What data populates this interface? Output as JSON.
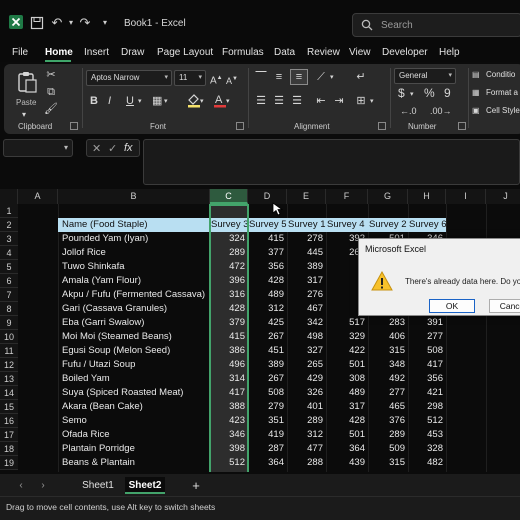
{
  "window": {
    "title": "Book1 - Excel"
  },
  "search": {
    "placeholder": "Search"
  },
  "menu": {
    "tabs": [
      "File",
      "Home",
      "Insert",
      "Draw",
      "Page Layout",
      "Formulas",
      "Data",
      "Review",
      "View",
      "Developer",
      "Help"
    ],
    "active": "Home"
  },
  "ribbon": {
    "clipboard": {
      "label": "Clipboard",
      "paste_label": "Paste"
    },
    "font": {
      "label": "Font",
      "name": "Aptos Narrow",
      "size": "11",
      "bold": "B",
      "italic": "I",
      "underline": "U"
    },
    "alignment": {
      "label": "Alignment"
    },
    "number": {
      "label": "Number",
      "format": "General",
      "currency": "$",
      "percent": "%",
      "comma": "9"
    },
    "styles": {
      "items": [
        "Conditio",
        "Format a",
        "Cell Style"
      ]
    }
  },
  "formula_bar": {
    "cancel": "✕",
    "enter": "✓",
    "fx": "fx"
  },
  "columns": [
    "A",
    "B",
    "C",
    "D",
    "E",
    "F",
    "G",
    "H",
    "I",
    "J"
  ],
  "table": {
    "headers": [
      "Name (Food Staple)",
      "Survey 3",
      "Survey 5",
      "Survey 1",
      "Survey 4",
      "Survey 2",
      "Survey 6"
    ],
    "rows": [
      [
        "Pounded Yam (Iyan)",
        "324",
        "415",
        "278",
        "392",
        "501",
        "346"
      ],
      [
        "Jollof Rice",
        "289",
        "377",
        "445",
        "267",
        "",
        ""
      ],
      [
        "Tuwo Shinkafa",
        "472",
        "356",
        "389",
        "4",
        "",
        ""
      ],
      [
        "Amala (Yam Flour)",
        "396",
        "428",
        "317",
        "5",
        "",
        ""
      ],
      [
        "Akpu / Fufu (Fermented Cassava)",
        "316",
        "489",
        "276",
        "3",
        "",
        ""
      ],
      [
        "Gari (Cassava Granules)",
        "428",
        "312",
        "467",
        "3",
        "",
        ""
      ],
      [
        "Eba (Garri Swalow)",
        "379",
        "425",
        "342",
        "517",
        "283",
        "391"
      ],
      [
        "Moi Moi (Steamed Beans)",
        "415",
        "267",
        "498",
        "329",
        "406",
        "277"
      ],
      [
        "Egusi Soup (Melon Seed)",
        "386",
        "451",
        "327",
        "422",
        "315",
        "508"
      ],
      [
        "Fufu / Utazi Soup",
        "496",
        "389",
        "265",
        "501",
        "348",
        "417"
      ],
      [
        "Boiled Yam",
        "314",
        "267",
        "429",
        "308",
        "492",
        "356"
      ],
      [
        "Suya (Spiced Roasted Meat)",
        "417",
        "508",
        "326",
        "489",
        "277",
        "421"
      ],
      [
        "Akara (Bean Cake)",
        "388",
        "279",
        "401",
        "317",
        "465",
        "298"
      ],
      [
        "Semo",
        "423",
        "351",
        "289",
        "428",
        "376",
        "512"
      ],
      [
        "Ofada Rice",
        "346",
        "419",
        "312",
        "501",
        "289",
        "453"
      ],
      [
        "Plantain Porridge",
        "398",
        "287",
        "477",
        "364",
        "509",
        "328"
      ],
      [
        "Beans & Plantain",
        "512",
        "364",
        "288",
        "439",
        "315",
        "482"
      ]
    ]
  },
  "dialog": {
    "title": "Microsoft Excel",
    "message": "There's already data here. Do yo",
    "ok": "OK",
    "cancel": "Cance"
  },
  "sheets": {
    "tabs": [
      "Sheet1",
      "Sheet2"
    ],
    "active": "Sheet2",
    "add": "+"
  },
  "status": {
    "text": "Drag to move cell contents, use Alt key to switch sheets"
  }
}
